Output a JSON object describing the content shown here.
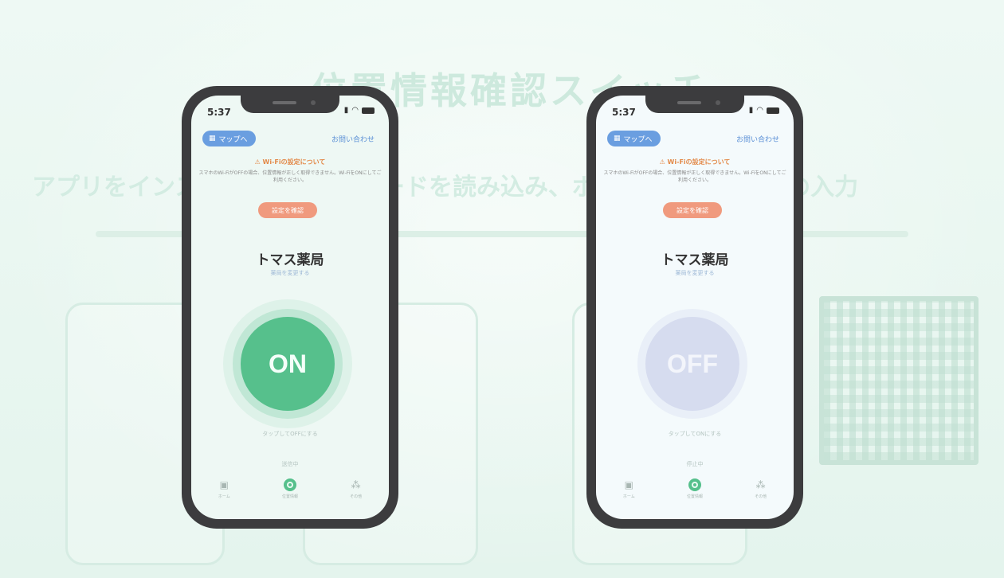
{
  "background": {
    "heading": "位置情報確認スイッチ",
    "subheading": "アプリをインストール後、QRコードを読み込み、ボタンを押して薬局の入力"
  },
  "phones": [
    {
      "status_time": "5:37",
      "map_button": "マップへ",
      "contact_link": "お問い合わせ",
      "warning_title": "Wi-Fiの設定について",
      "warning_body": "スマホのWi-FiがOFFの場合、位置情報が正しく取得できません。Wi-FiをONにしてご利用ください。",
      "check_button": "設定を確認",
      "pharmacy_name": "トマス薬局",
      "pharmacy_sub": "薬局を変更する",
      "toggle_label": "ON",
      "toggle_state": "on",
      "hint": "タップしてOFFにする",
      "hint2": "送信中",
      "tabs": [
        {
          "label": "ホーム"
        },
        {
          "label": "位置情報"
        },
        {
          "label": "その他"
        }
      ]
    },
    {
      "status_time": "5:37",
      "map_button": "マップへ",
      "contact_link": "お問い合わせ",
      "warning_title": "Wi-Fiの設定について",
      "warning_body": "スマホのWi-FiがOFFの場合、位置情報が正しく取得できません。Wi-FiをONにしてご利用ください。",
      "check_button": "設定を確認",
      "pharmacy_name": "トマス薬局",
      "pharmacy_sub": "薬局を変更する",
      "toggle_label": "OFF",
      "toggle_state": "off",
      "hint": "タップしてONにする",
      "hint2": "停止中",
      "tabs": [
        {
          "label": "ホーム"
        },
        {
          "label": "位置情報"
        },
        {
          "label": "その他"
        }
      ]
    }
  ],
  "colors": {
    "on": "#56c08c",
    "off": "#d6dcef",
    "map_button": "#6a9ee0",
    "check_button": "#f09a7e"
  }
}
